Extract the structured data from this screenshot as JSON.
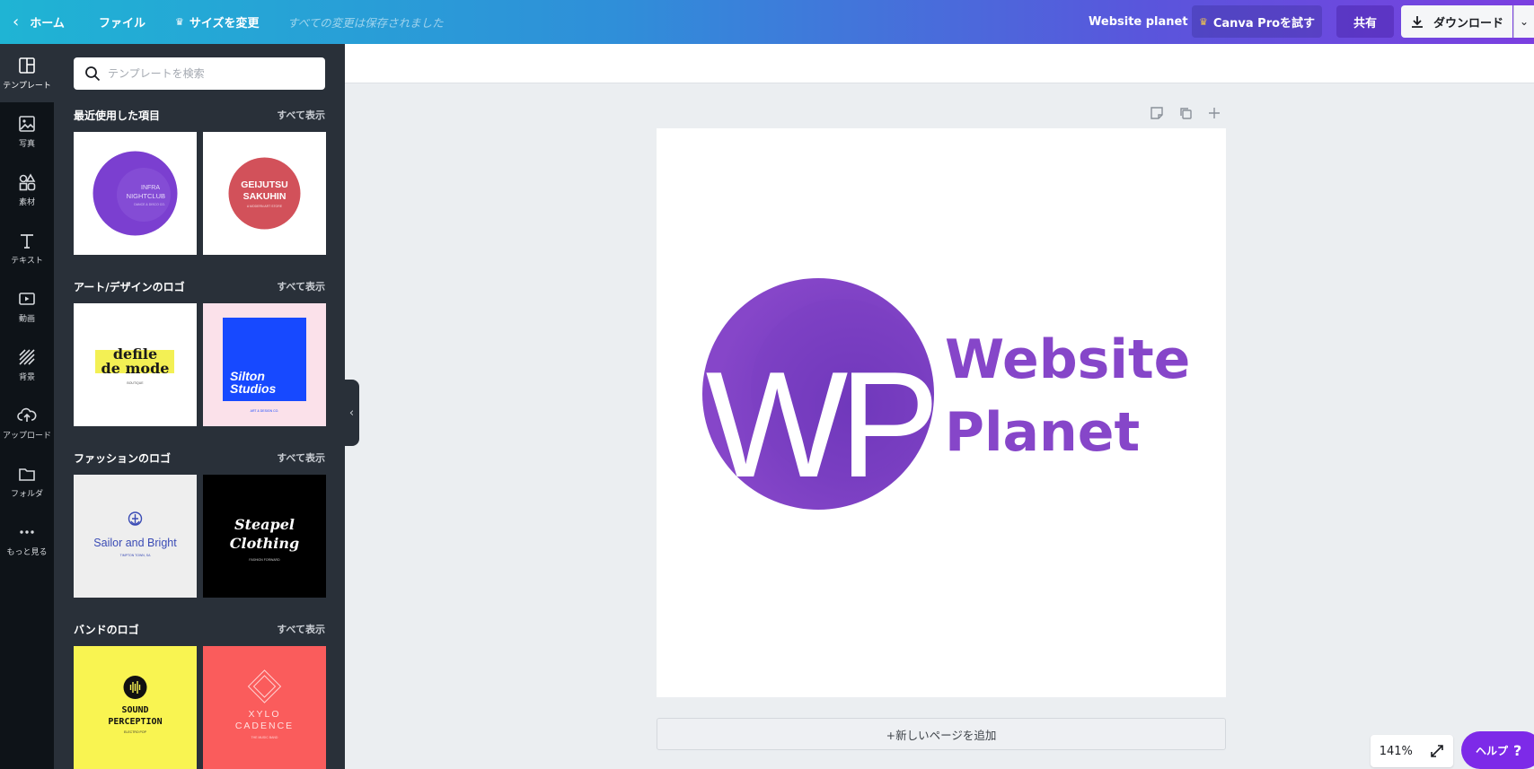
{
  "topbar": {
    "home_label": "ホーム",
    "file_label": "ファイル",
    "resize_label": "サイズを変更",
    "saved_status": "すべての変更は保存されました",
    "design_title": "Website planet",
    "pro_label": "Canva Proを試す",
    "share_label": "共有",
    "download_label": "ダウンロード"
  },
  "rail": {
    "items": [
      {
        "label": "テンプレート",
        "icon": "template-icon"
      },
      {
        "label": "写真",
        "icon": "photo-icon"
      },
      {
        "label": "素材",
        "icon": "elements-icon"
      },
      {
        "label": "テキスト",
        "icon": "text-icon"
      },
      {
        "label": "動画",
        "icon": "video-icon"
      },
      {
        "label": "背景",
        "icon": "background-icon"
      },
      {
        "label": "アップロード",
        "icon": "upload-icon"
      },
      {
        "label": "フォルダ",
        "icon": "folder-icon"
      },
      {
        "label": "もっと見る",
        "icon": "more-icon"
      }
    ]
  },
  "panel": {
    "search_placeholder": "テンプレートを検索",
    "see_all": "すべて表示",
    "sections": [
      {
        "title": "最近使用した項目"
      },
      {
        "title": "アート/デザインのロゴ"
      },
      {
        "title": "ファッションのロゴ"
      },
      {
        "title": "バンドのロゴ"
      }
    ],
    "thumbs": {
      "t1": {
        "line1": "INFRA",
        "line2": "NIGHTCLUB",
        "line3": "DANCE & DISCO CO."
      },
      "t2": {
        "line1": "GEIJUTSU",
        "line2": "SAKUHIN",
        "line3": "A MODERN ART STORE"
      },
      "t3": {
        "line1": "defile",
        "line2": "de mode",
        "line3": "BOUTIQUE"
      },
      "t4": {
        "line1": "Silton",
        "line2": "Studios",
        "line3": "ART & DESIGN CO."
      },
      "t5": {
        "line1": "Sailor and Bright",
        "line2": "TIMPTON TOWN, SA"
      },
      "t6": {
        "line1": "Steapel",
        "line2": "Clothing",
        "line3": "FASHION FORWARD"
      },
      "t7": {
        "line1": "SOUND",
        "line2": "PERCEPTION",
        "line3": "ELECTRO POP"
      },
      "t8": {
        "line1": "XYLO",
        "line2": "CADENCE",
        "line3": "THE MUSIC BAND"
      }
    }
  },
  "canvas": {
    "logo_letters": "WP",
    "logo_line1": "Website",
    "logo_line2": "Planet",
    "add_page_label": "+新しいページを追加",
    "zoom": "141%",
    "help_label": "ヘルプ",
    "help_icon": "?",
    "colors": {
      "brand_purple": "#8646c9",
      "accent": "#7d2ae8"
    }
  }
}
